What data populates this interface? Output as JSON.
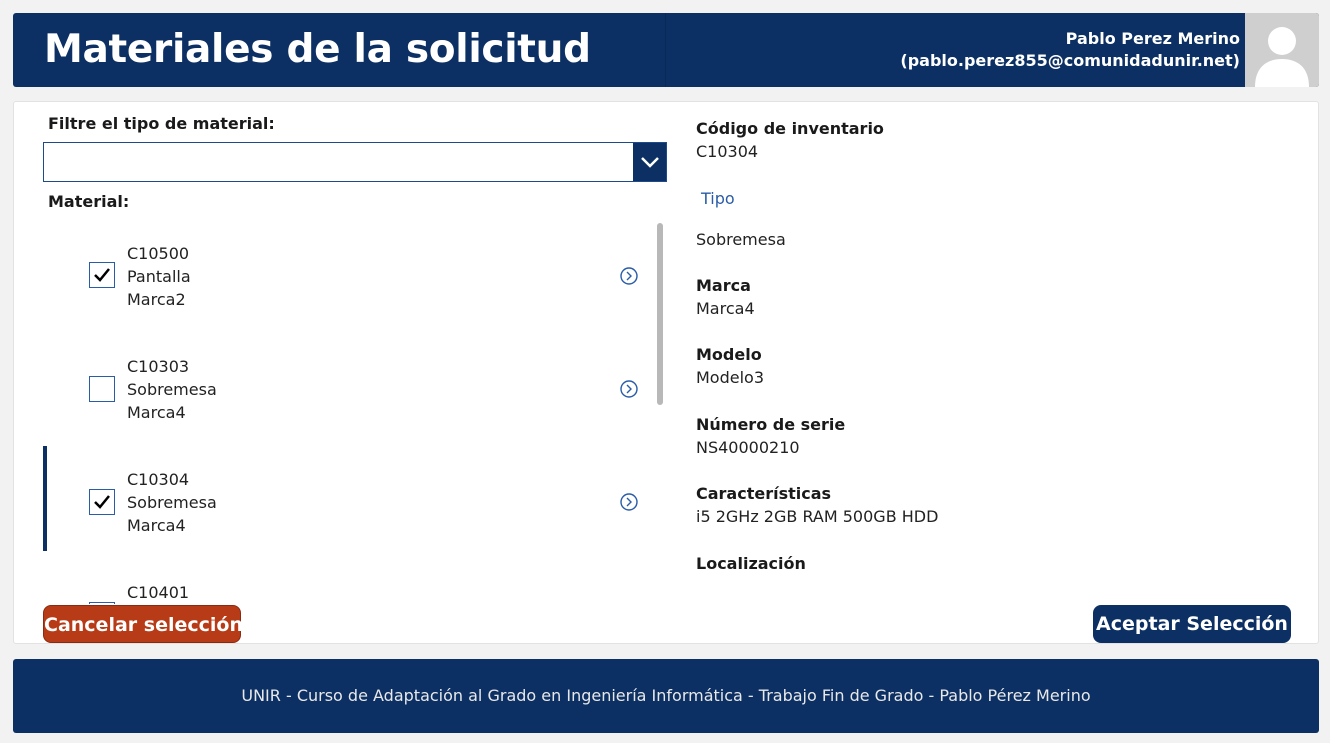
{
  "header": {
    "title": "Materiales de la solicitud",
    "user_name": "Pablo Perez Merino",
    "user_email": "(pablo.perez855@comunidadunir.net)",
    "avatar_icon": "user-silhouette-icon"
  },
  "filter": {
    "label": "Filtre el tipo de material:",
    "selected_value": ""
  },
  "material_label": "Material:",
  "materials": [
    {
      "code": "C10500",
      "type": "Pantalla",
      "brand": "Marca2",
      "checked": true,
      "selected": false
    },
    {
      "code": "C10303",
      "type": "Sobremesa",
      "brand": "Marca4",
      "checked": false,
      "selected": false
    },
    {
      "code": "C10304",
      "type": "Sobremesa",
      "brand": "Marca4",
      "checked": true,
      "selected": true
    },
    {
      "code": "C10401",
      "type": "",
      "brand": "",
      "checked": true,
      "selected": false
    }
  ],
  "details": {
    "inventory_label": "Código de inventario",
    "inventory_value": "C10304",
    "type_label": "Tipo",
    "type_value": "Sobremesa",
    "brand_label": "Marca",
    "brand_value": "Marca4",
    "model_label": "Modelo",
    "model_value": "Modelo3",
    "serial_label": "Número de serie",
    "serial_value": "NS40000210",
    "features_label": "Características",
    "features_value": "i5 2GHz 2GB RAM 500GB HDD",
    "location_label": "Localización"
  },
  "buttons": {
    "cancel": "Cancelar selección",
    "accept": "Aceptar Selección"
  },
  "footer": {
    "text": "UNIR - Curso de Adaptación al Grado en Ingeniería Informática - Trabajo Fin de Grado - Pablo Pérez Merino"
  },
  "colors": {
    "primary": "#0c3063",
    "cancel": "#b83b17",
    "link": "#2a5ca8"
  }
}
